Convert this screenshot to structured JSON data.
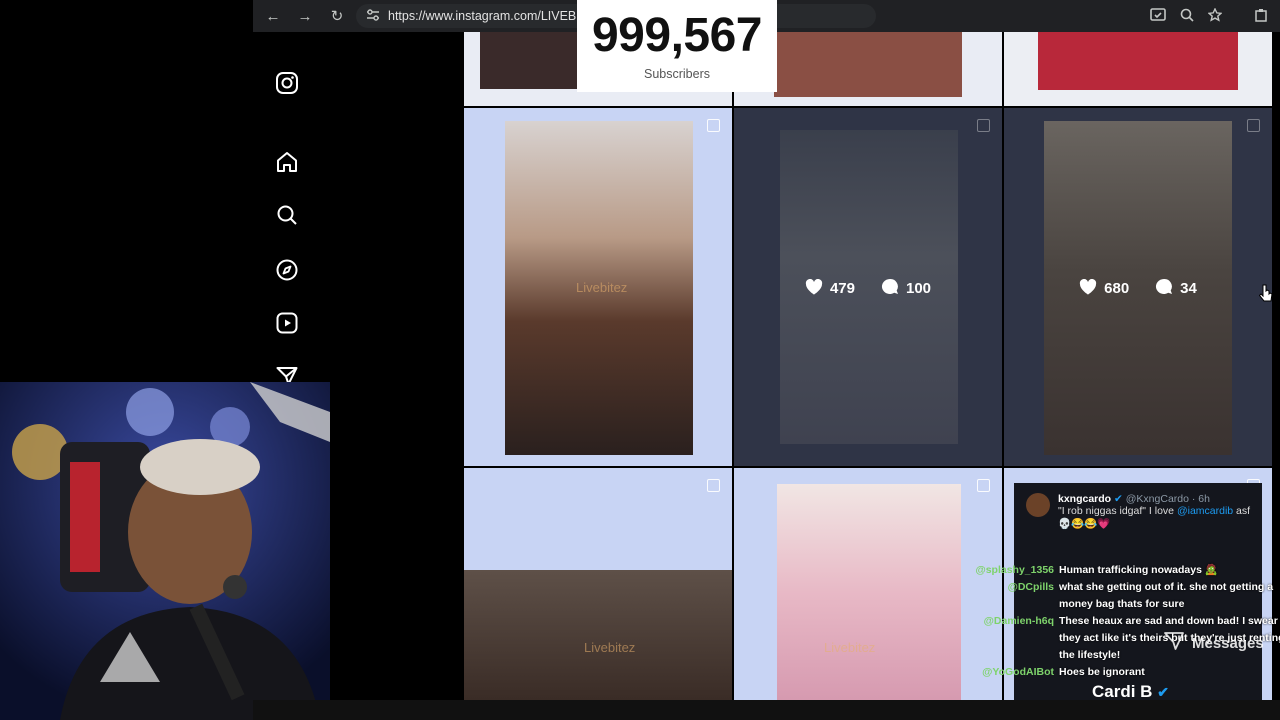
{
  "browser": {
    "url": "https://www.instagram.com/LIVEB",
    "back": "←",
    "forward": "→",
    "reload": "↻"
  },
  "counter": {
    "value": "999,567",
    "label": "Subscribers"
  },
  "sidebar": {
    "items": [
      {
        "icon": "instagram-logo-icon"
      },
      {
        "icon": "home-icon"
      },
      {
        "icon": "search-icon"
      },
      {
        "icon": "explore-icon"
      },
      {
        "icon": "reels-icon"
      },
      {
        "icon": "messages-icon"
      }
    ]
  },
  "grid": {
    "posts": [
      {
        "likes": "479",
        "comments": "100"
      },
      {
        "likes": "680",
        "comments": "34"
      }
    ],
    "watermark": "Livebitez"
  },
  "tweet": {
    "name": "kxngcardo",
    "handle": "@KxngCardo · 6h",
    "text_a": "\"I rob niggas idgaf\" I love ",
    "mention": "@iamcardib",
    "text_b": " asf",
    "emoji": "💀😂😂💗",
    "footer": "Cardi B"
  },
  "chat": [
    {
      "user": "@splashy_1356",
      "msg": "Human trafficking nowadays 🧟",
      "cont": []
    },
    {
      "user": "@DCpills",
      "msg": "what she getting out of it. she not getting a",
      "cont": [
        "money bag thats for sure"
      ]
    },
    {
      "user": "@Damien-h6q",
      "msg": "These heaux are sad and down bad! I swear",
      "cont": [
        "they act like it's theirs but they're just renting",
        "the lifestyle!"
      ]
    },
    {
      "user": "@YoGodAIBot",
      "msg": "Hoes be ignorant",
      "cont": []
    }
  ],
  "messages_label": "Messages",
  "colors": {
    "chrome": "#202124",
    "selected_cell": "#c8d4f4",
    "overlay_dark": "#2f3446",
    "chat_user": "#7ed36b"
  }
}
